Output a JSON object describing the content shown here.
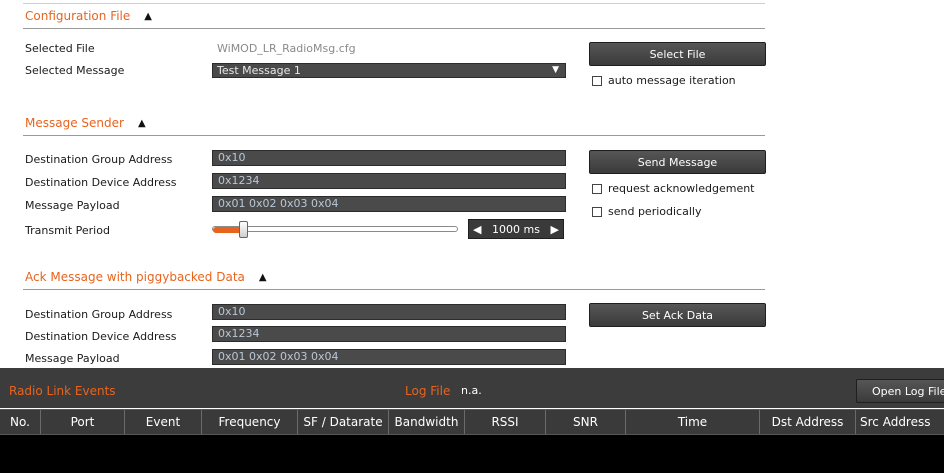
{
  "config_section": {
    "title": "Configuration File",
    "toggle": "▲",
    "selected_file_label": "Selected File",
    "selected_file_value": "WiMOD_LR_RadioMsg.cfg",
    "selected_message_label": "Selected Message",
    "selected_message_value": "Test Message 1",
    "select_file_button": "Select File",
    "auto_iteration_label": "auto message iteration",
    "auto_iteration_checked": false
  },
  "sender_section": {
    "title": "Message Sender",
    "toggle": "▲",
    "group_address_label": "Destination Group Address",
    "group_address_value": "0x10",
    "device_address_label": "Destination Device Address",
    "device_address_value": "0x1234",
    "payload_label": "Message Payload",
    "payload_value": "0x01 0x02 0x03 0x04",
    "transmit_period_label": "Transmit Period",
    "transmit_period_value": "1000 ms",
    "transmit_period_fraction": 0.12,
    "send_button": "Send Message",
    "request_ack_label": "request acknowledgement",
    "request_ack_checked": false,
    "send_periodically_label": "send periodically",
    "send_periodically_checked": false
  },
  "ack_section": {
    "title": "Ack Message with piggybacked Data",
    "toggle": "▲",
    "group_address_label": "Destination Group Address",
    "group_address_value": "0x10",
    "device_address_label": "Destination Device Address",
    "device_address_value": "0x1234",
    "payload_label": "Message Payload",
    "payload_value": "0x01 0x02 0x03 0x04",
    "set_ack_button": "Set Ack Data"
  },
  "events_panel": {
    "title": "Radio Link Events",
    "log_file_label": "Log File",
    "log_file_value": "n.a.",
    "open_log_button": "Open Log File",
    "columns": [
      "No.",
      "Port",
      "Event",
      "Frequency",
      "SF / Datarate",
      "Bandwidth",
      "RSSI",
      "SNR",
      "Time",
      "Dst Address",
      "Src Address"
    ]
  },
  "colors": {
    "accent": "#e8641e",
    "field_bg": "#4a4a4a",
    "panel_bg": "#3c3c3c"
  }
}
